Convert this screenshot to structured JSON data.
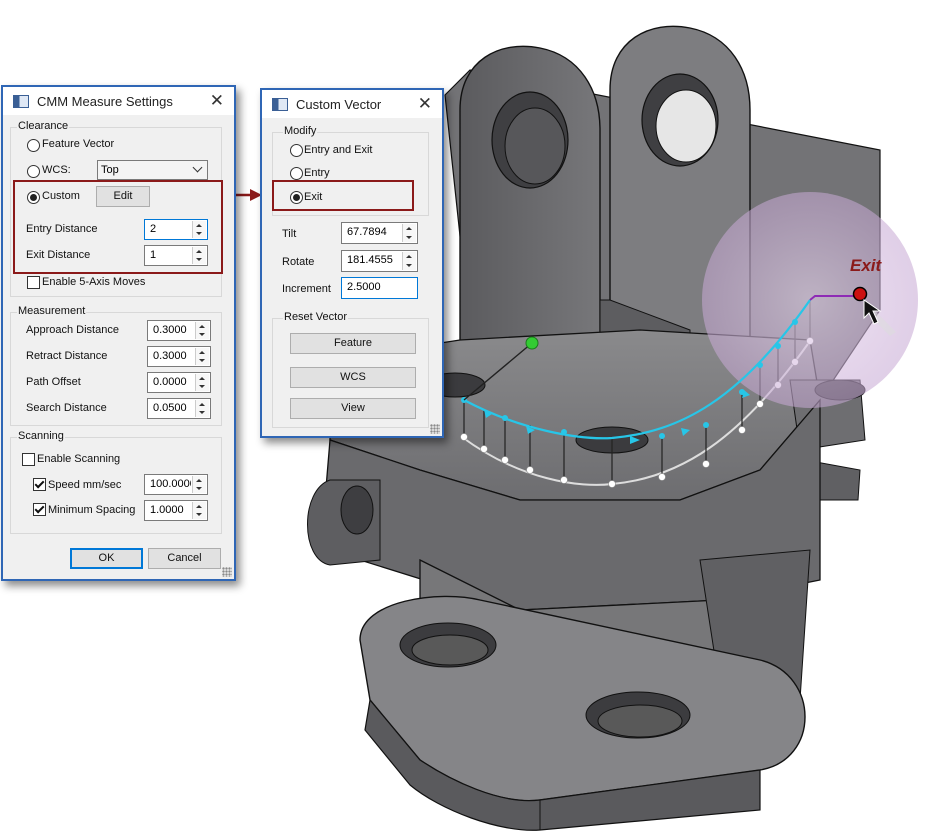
{
  "cmm_dialog": {
    "title": "CMM Measure Settings",
    "clearance": {
      "label": "Clearance",
      "feature_vector": "Feature Vector",
      "wcs_label": "WCS:",
      "wcs_value": "Top",
      "custom_label": "Custom",
      "edit_button": "Edit",
      "entry_distance_label": "Entry Distance",
      "entry_distance": "2",
      "exit_distance_label": "Exit Distance",
      "exit_distance": "1",
      "enable_5axis": "Enable 5-Axis Moves"
    },
    "measurement": {
      "label": "Measurement",
      "approach_label": "Approach Distance",
      "approach": "0.3000",
      "retract_label": "Retract Distance",
      "retract": "0.3000",
      "path_offset_label": "Path Offset",
      "path_offset": "0.0000",
      "search_label": "Search Distance",
      "search": "0.0500"
    },
    "scanning": {
      "label": "Scanning",
      "enable_scanning": "Enable Scanning",
      "speed_label": "Speed mm/sec",
      "speed": "100.0000",
      "min_spacing_label": "Minimum Spacing",
      "min_spacing": "1.0000"
    },
    "ok": "OK",
    "cancel": "Cancel"
  },
  "vector_dialog": {
    "title": "Custom Vector",
    "modify_label": "Modify",
    "entry_and_exit": "Entry and Exit",
    "entry": "Entry",
    "exit": "Exit",
    "tilt_label": "Tilt",
    "tilt": "67.7894",
    "rotate_label": "Rotate",
    "rotate": "181.4555",
    "increment_label": "Increment",
    "increment": "2.5000",
    "reset_label": "Reset Vector",
    "feature_button": "Feature",
    "wcs_button": "WCS",
    "view_button": "View"
  },
  "viewport": {
    "exit_annotation": "Exit"
  },
  "colors": {
    "highlight": "#8b1a1a",
    "dialog_border": "#2f66b5",
    "path": "#27c6e8",
    "entry_point": "#33cc33",
    "exit_point": "#cc1111",
    "sphere": "#cdb7d9"
  }
}
